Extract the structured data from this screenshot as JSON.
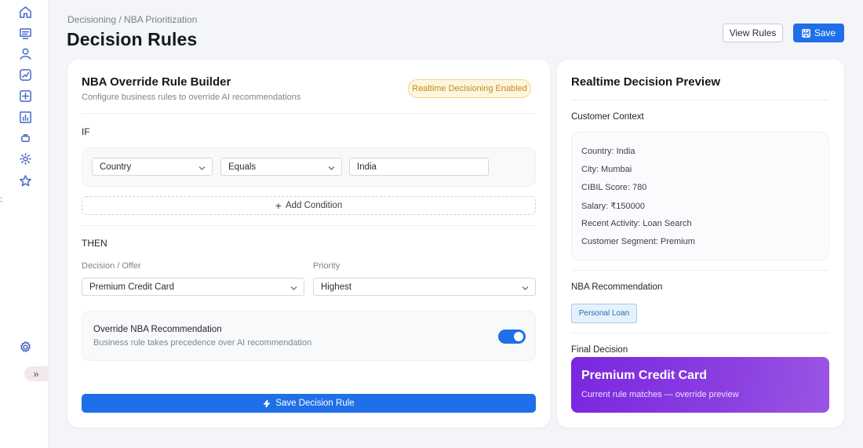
{
  "sidebar": {
    "icons": [
      "home-icon",
      "list-icon",
      "user-icon",
      "analytics-icon",
      "grid-icon",
      "bar-chart-icon",
      "bag-icon",
      "gear-alt-icon",
      "star-icon",
      "settings-icon"
    ],
    "expand_label": "»",
    "dots": ":"
  },
  "header": {
    "breadcrumb": "Decisioning / NBA Prioritization",
    "title": "Decision Rules",
    "view_rules_label": "View Rules",
    "save_label": "Save"
  },
  "builder": {
    "title": "NBA Override Rule Builder",
    "subtitle": "Configure business rules to override AI recommendations",
    "badge": "Realtime Decisioning Enabled",
    "if_label": "IF",
    "condition": {
      "field": "Country",
      "operator": "Equals",
      "value": "India"
    },
    "add_condition_label": "Add Condition",
    "then_label": "THEN",
    "decision_label": "Decision / Offer",
    "decision_value": "Premium Credit Card",
    "priority_label": "Priority",
    "priority_value": "Highest",
    "override": {
      "title": "Override NBA Recommendation",
      "subtitle": "Business rule takes precedence over AI recommendation",
      "enabled": true
    },
    "save_rule_label": "Save Decision Rule"
  },
  "preview": {
    "title": "Realtime Decision Preview",
    "context_label": "Customer Context",
    "context_items": [
      "Country: India",
      "City: Mumbai",
      "CIBIL Score: 780",
      "Salary: ₹150000",
      "Recent Activity: Loan Search",
      "Customer Segment: Premium"
    ],
    "nba_label": "NBA Recommendation",
    "nba_value": "Personal Loan",
    "final_label": "Final Decision",
    "final_title": "Premium Credit Card",
    "final_subtitle": "Current rule matches — override preview"
  },
  "colors": {
    "primary": "#1f6fe8",
    "badge_bg": "#fdf6df",
    "badge_text": "#c88a16",
    "final_gradient_start": "#7a27e0",
    "final_gradient_end": "#9b55e3"
  }
}
